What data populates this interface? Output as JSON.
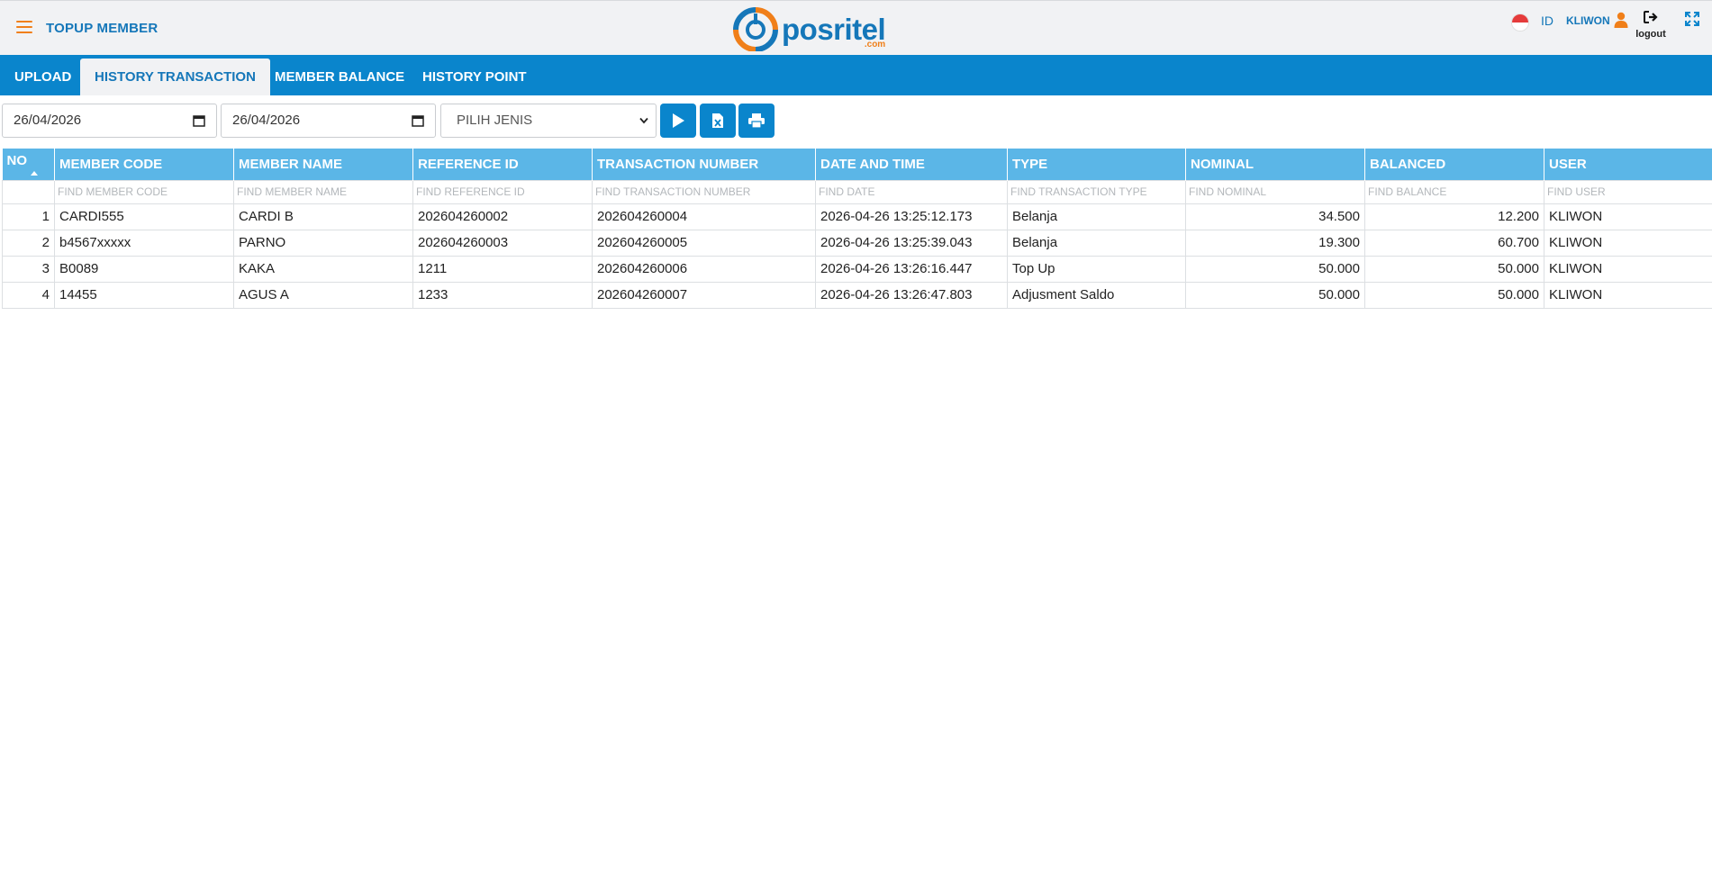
{
  "header": {
    "title": "TOPUP MEMBER",
    "logo_text": "posritel",
    "logo_suffix": ".com",
    "language": "ID",
    "user": "KLIWON",
    "logout_label": "logout",
    "icons": {
      "menu": "hamburger-icon",
      "flag": "indonesia-flag-icon",
      "user": "user-icon",
      "logout": "sign-out-icon",
      "expand": "expand-icon"
    }
  },
  "tabs": [
    {
      "label": "UPLOAD",
      "active": false
    },
    {
      "label": "HISTORY TRANSACTION",
      "active": true
    },
    {
      "label": "MEMBER BALANCE",
      "active": false
    },
    {
      "label": "HISTORY POINT",
      "active": false
    }
  ],
  "filters": {
    "date_from": "26/04/2026",
    "date_to": "26/04/2026",
    "type_select": "PILIH JENIS",
    "buttons": [
      "play-icon",
      "excel-icon",
      "print-icon"
    ]
  },
  "table": {
    "columns": [
      "NO",
      "MEMBER CODE",
      "MEMBER NAME",
      "REFERENCE ID",
      "TRANSACTION NUMBER",
      "DATE AND TIME",
      "TYPE",
      "NOMINAL",
      "BALANCED",
      "USER"
    ],
    "filter_placeholders": [
      "",
      "FIND MEMBER CODE",
      "FIND MEMBER NAME",
      "FIND REFERENCE ID",
      "FIND TRANSACTION NUMBER",
      "FIND DATE",
      "FIND TRANSACTION TYPE",
      "FIND NOMINAL",
      "FIND BALANCE",
      "FIND USER"
    ],
    "rows": [
      [
        "1",
        "CARDI555",
        "CARDI B",
        "202604260002",
        "202604260004",
        "2026-04-26 13:25:12.173",
        "Belanja",
        "34.500",
        "12.200",
        "KLIWON"
      ],
      [
        "2",
        "b4567xxxxx",
        "PARNO",
        "202604260003",
        "202604260005",
        "2026-04-26 13:25:39.043",
        "Belanja",
        "19.300",
        "60.700",
        "KLIWON"
      ],
      [
        "3",
        "B0089",
        "KAKA",
        "1211",
        "202604260006",
        "2026-04-26 13:26:16.447",
        "Top Up",
        "50.000",
        "50.000",
        "KLIWON"
      ],
      [
        "4",
        "14455",
        "AGUS A",
        "1233",
        "202604260007",
        "2026-04-26 13:26:47.803",
        "Adjusment Saldo",
        "50.000",
        "50.000",
        "KLIWON"
      ]
    ]
  },
  "colors": {
    "primary": "#0a85cc",
    "header_bg": "#f1f2f4",
    "table_header": "#5bb6e7",
    "accent_orange": "#f07f19",
    "brand_blue": "#1577b9"
  }
}
